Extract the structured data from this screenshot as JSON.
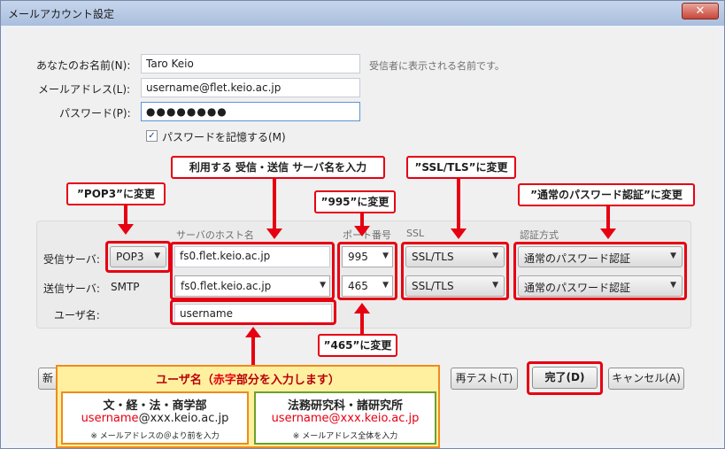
{
  "window": {
    "title": "メールアカウント設定",
    "close": "✕"
  },
  "form": {
    "name_label": "あなたのお名前(N):",
    "name_value": "Taro Keio",
    "name_hint": "受信者に表示される名前です。",
    "email_label": "メールアドレス(L):",
    "email_value": "username@flet.keio.ac.jp",
    "password_label": "パスワード(P):",
    "password_value": "●●●●●●●●",
    "remember_label": "パスワードを記憶する(M)",
    "remember_checked": "✓"
  },
  "server": {
    "col_host": "サーバのホスト名",
    "col_port": "ポート番号",
    "col_ssl": "SSL",
    "col_auth": "認証方式",
    "incoming_label": "受信サーバ:",
    "incoming_protocol": "POP3",
    "incoming_host": "fs0.flet.keio.ac.jp",
    "incoming_port": "995",
    "incoming_ssl": "SSL/TLS",
    "incoming_auth": "通常のパスワード認証",
    "outgoing_label": "送信サーバ:",
    "outgoing_protocol": "SMTP",
    "outgoing_host": "fs0.flet.keio.ac.jp",
    "outgoing_port": "465",
    "outgoing_ssl": "SSL/TLS",
    "outgoing_auth": "通常のパスワード認証",
    "user_label": "ユーザ名:",
    "user_value": "username",
    "dropdown_arrow": "▼"
  },
  "buttons": {
    "new": "新",
    "retest": "再テスト(T)",
    "done": "完了(D)",
    "cancel": "キャンセル(A)"
  },
  "callouts": {
    "pop3": "”POP3”に変更",
    "server_name": "利用する 受信・送信 サーバ名を入力",
    "port_995": "”995”に変更",
    "ssl_tls": "”SSL/TLS”に変更",
    "auth": "”通常のパスワード認証”に変更",
    "port_465": "”465”に変更"
  },
  "info": {
    "title_a": "ユーザ名（",
    "title_red": "赤字",
    "title_b": "部分を入力します）",
    "left_heading": "文・経・法・商学部",
    "left_user": "username",
    "left_domain": "@xxx.keio.ac.jp",
    "left_note": "※ メールアドレスの＠より前を入力",
    "right_heading": "法務研究科・諸研究所",
    "right_email": "username@xxx.keio.ac.jp",
    "right_note": "※ メールアドレス全体を入力"
  },
  "colors": {
    "annotation_red": "#e60012",
    "info_border": "#f08a1c",
    "info_green": "#6ca02c",
    "info_bg": "#fff0a0"
  }
}
